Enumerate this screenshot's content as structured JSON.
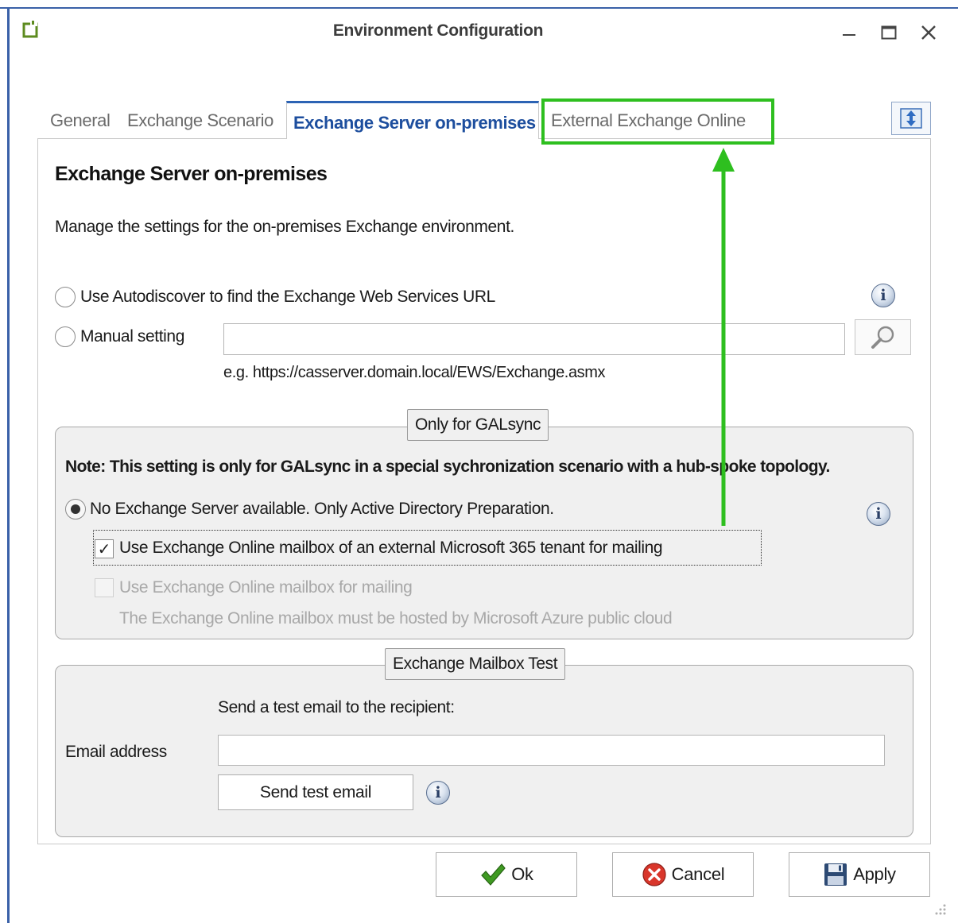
{
  "window": {
    "title": "Environment Configuration"
  },
  "tabs": [
    {
      "label": "General"
    },
    {
      "label": "Exchange Scenario"
    },
    {
      "label": "Exchange Server on-premises",
      "active": true
    },
    {
      "label": "External Exchange Online",
      "highlighted": true
    }
  ],
  "page": {
    "heading": "Exchange Server on-premises",
    "subtitle": "Manage the settings for the on-premises Exchange environment.",
    "autodiscover_label": "Use Autodiscover to find the Exchange Web Services URL",
    "manual_label": "Manual setting",
    "manual_value": "",
    "example": "e.g. https://casserver.domain.local/EWS/Exchange.asmx"
  },
  "galsync": {
    "legend": "Only for GALsync",
    "note": "Note: This setting is only for GALsync in a special sychronization scenario with a hub-spoke topology.",
    "no_exchange_label": "No Exchange Server available. Only Active Directory Preparation.",
    "external_tenant_label": "Use Exchange Online mailbox of an external Microsoft 365 tenant for mailing",
    "eo_mailbox_label": "Use Exchange Online mailbox for mailing",
    "azure_note": "The Exchange Online mailbox must be hosted by Microsoft Azure public cloud"
  },
  "mailbox_test": {
    "legend": "Exchange Mailbox Test",
    "send_to_label": "Send a test email to the recipient:",
    "email_label": "Email address",
    "email_value": "",
    "send_button": "Send test email"
  },
  "buttons": {
    "ok": "Ok",
    "cancel": "Cancel",
    "apply": "Apply"
  },
  "icons": {
    "check": "✓",
    "info": "i",
    "app": "app-icon",
    "search": "magnifier-icon"
  },
  "colors": {
    "highlight": "#2ebf1f",
    "active_tab": "#1d4e9e",
    "window_border": "#3a61a8"
  }
}
